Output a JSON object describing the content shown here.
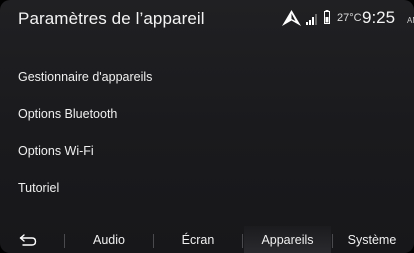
{
  "header": {
    "title": "Paramètres de l’appareil",
    "temperature": "27°C",
    "time": "9:25",
    "ampm": "AM",
    "icons": [
      "navigation-arrow-icon",
      "signal-strength-icon",
      "battery-icon"
    ]
  },
  "menu": {
    "items": [
      {
        "label": "Gestionnaire d'appareils"
      },
      {
        "label": "Options Bluetooth"
      },
      {
        "label": "Options Wi-Fi"
      },
      {
        "label": "Tutoriel"
      }
    ]
  },
  "tabs": {
    "back_icon": "back-arrow-icon",
    "items": [
      {
        "label": "Audio"
      },
      {
        "label": "Écran"
      },
      {
        "label": "Appareils",
        "active": true
      },
      {
        "label": "Système"
      }
    ]
  },
  "colors": {
    "background": "#1b1b1e",
    "text": "#f0f0f0",
    "active_tab": "#2a2a2e"
  }
}
